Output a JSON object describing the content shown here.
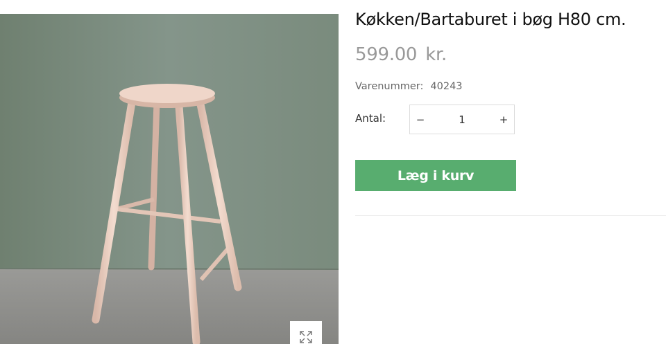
{
  "product": {
    "title": "Køkken/Bartaburet i bøg H80 cm.",
    "price_amount": "599.00",
    "price_currency": "kr.",
    "sku_label": "Varenummer:",
    "sku_value": "40243"
  },
  "quantity": {
    "label": "Antal:",
    "value": "1",
    "decrement_symbol": "−",
    "increment_symbol": "+"
  },
  "cart": {
    "button_label": "Læg i kurv",
    "button_color": "#58ad6f"
  },
  "gallery": {
    "zoom_icon": "expand-arrows-icon",
    "wall_color": "#7e8e80",
    "floor_color": "#8f8f8c",
    "stool_color": "#e9cdbf"
  }
}
